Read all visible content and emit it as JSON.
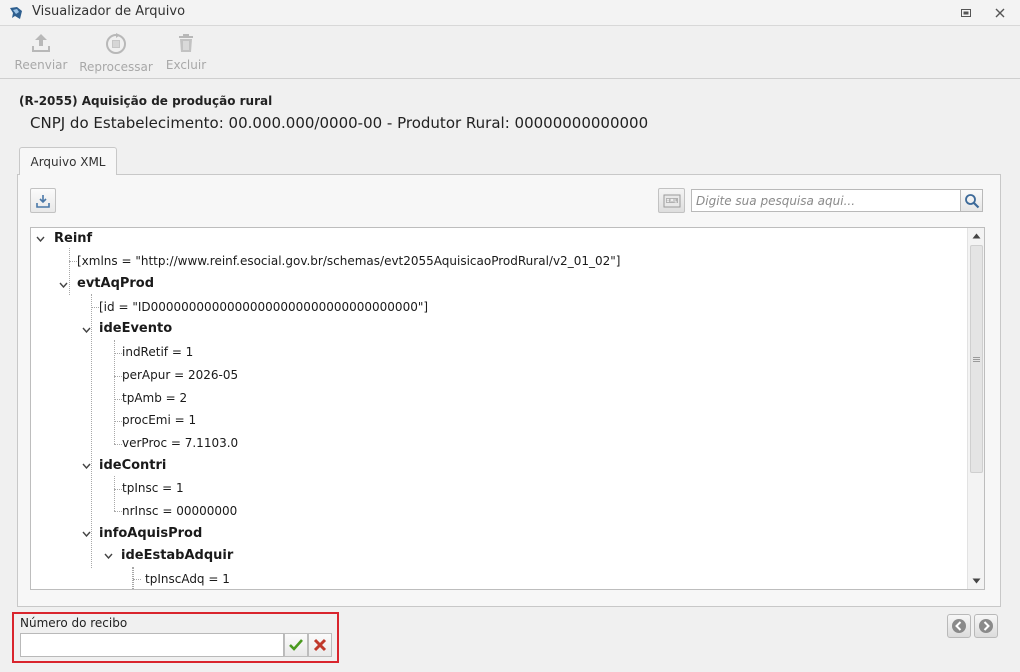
{
  "window": {
    "title": "Visualizador de Arquivo"
  },
  "toolbar": {
    "resend_label": "Reenviar",
    "reprocess_label": "Reprocessar",
    "delete_label": "Excluir"
  },
  "header": {
    "event_title": "(R-2055) Aquisição de produção rural",
    "event_subtitle": "CNPJ do Estabelecimento: 00.000.000/0000-00 - Produtor Rural: 00000000000000"
  },
  "tabs": [
    {
      "label": "Arquivo XML",
      "active": true
    }
  ],
  "search": {
    "placeholder": "Digite sua pesquisa aqui...",
    "value": ""
  },
  "tree": {
    "nodes": [
      {
        "label": "Reinf",
        "type": "element",
        "expanded": true
      },
      {
        "label": "[xmlns = \"http://www.reinf.esocial.gov.br/schemas/evt2055AquisicaoProdRural/v2_01_02\"]",
        "type": "attribute"
      },
      {
        "label": "evtAqProd",
        "type": "element",
        "expanded": true
      },
      {
        "label": "[id = \"ID00000000000000000000000000000000000\"]",
        "type": "attribute"
      },
      {
        "label": "ideEvento",
        "type": "element",
        "expanded": true
      },
      {
        "label": "indRetif = 1",
        "type": "value"
      },
      {
        "label": "perApur = 2026-05",
        "type": "value"
      },
      {
        "label": "tpAmb = 2",
        "type": "value"
      },
      {
        "label": "procEmi = 1",
        "type": "value"
      },
      {
        "label": "verProc = 7.1103.0",
        "type": "value"
      },
      {
        "label": "ideContri",
        "type": "element",
        "expanded": true
      },
      {
        "label": "tpInsc = 1",
        "type": "value"
      },
      {
        "label": "nrInsc = 00000000",
        "type": "value"
      },
      {
        "label": "infoAquisProd",
        "type": "element",
        "expanded": true
      },
      {
        "label": "ideEstabAdquir",
        "type": "element",
        "expanded": true
      },
      {
        "label": "tpInscAdq = 1",
        "type": "value"
      }
    ]
  },
  "receipt": {
    "label": "Número do recibo",
    "value": ""
  },
  "icons": {
    "app": "app-icon",
    "resend": "upload-icon",
    "reprocess": "reprocess-icon",
    "delete": "trash-icon",
    "download": "download-icon",
    "xml_view": "xml-icon",
    "search": "search-icon",
    "confirm": "checkmark-icon",
    "cancel": "cross-icon",
    "prev": "arrow-left-icon",
    "next": "arrow-right-icon"
  },
  "colors": {
    "highlight_border": "#d9252d",
    "confirm_green": "#4a9a1f",
    "cancel_red": "#c0392b"
  }
}
